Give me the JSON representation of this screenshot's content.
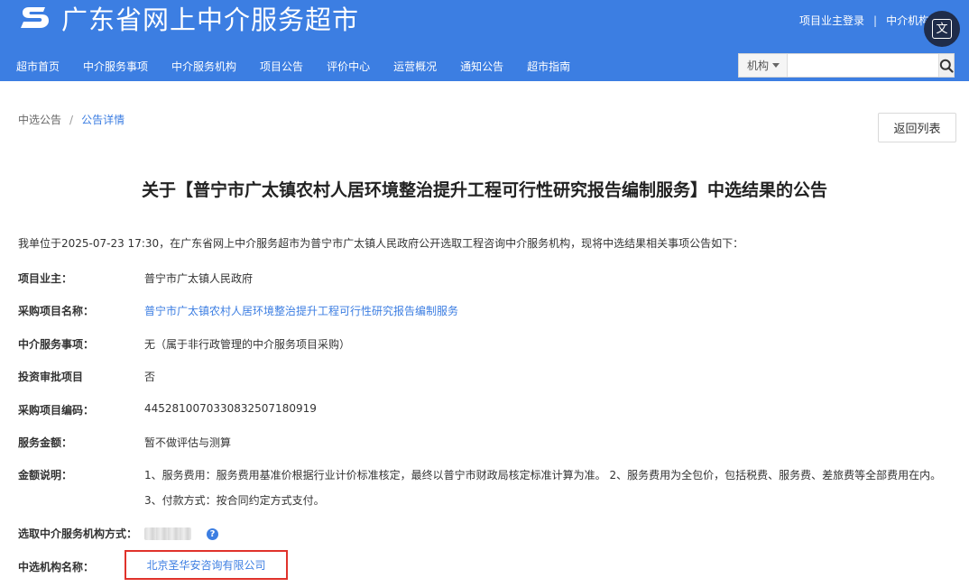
{
  "header": {
    "site_name": "广东省网上中介服务超市",
    "top_links": {
      "owner_login": "项目业主登录",
      "separator": "|",
      "agency_login": "中介机构"
    },
    "translate_label": "文",
    "nav": [
      "超市首页",
      "中介服务事项",
      "中介服务机构",
      "项目公告",
      "评价中心",
      "运营概况",
      "通知公告",
      "超市指南"
    ],
    "search": {
      "category": "机构",
      "value": "",
      "placeholder": ""
    }
  },
  "breadcrumb": {
    "parent": "中选公告",
    "separator": "/",
    "current": "公告详情"
  },
  "back_button": "返回列表",
  "title": "关于【普宁市广太镇农村人居环境整治提升工程可行性研究报告编制服务】中选结果的公告",
  "intro": "我单位于2025-07-23 17:30，在广东省网上中介服务超市为普宁市广太镇人民政府公开选取工程咨询中介服务机构，现将中选结果相关事项公告如下：",
  "fields": {
    "owner": {
      "label": "项目业主：",
      "value": "普宁市广太镇人民政府"
    },
    "project_name": {
      "label": "采购项目名称：",
      "value": "普宁市广太镇农村人居环境整治提升工程可行性研究报告编制服务"
    },
    "service_item": {
      "label": "中介服务事项：",
      "value": "无（属于非行政管理的中介服务项目采购）"
    },
    "investment_approval": {
      "label": "投资审批项目",
      "value": "否"
    },
    "project_code": {
      "label": "采购项目编码：",
      "value": "445281007033083250718091​9"
    },
    "amount": {
      "label": "服务金额：",
      "value": "暂不做评估与测算"
    },
    "amount_note": {
      "label": "金额说明：",
      "line1": "1、服务费用：服务费用基准价根据行业计价标准核定，最终以普宁市财政局核定标准计算为准。 2、服务费用为全包价，包括税费、服务费、差旅费等全部费用在内。",
      "line2": "3、付款方式：按合同约定方式支付。"
    },
    "selection_method": {
      "label": "选取中介服务机构方式："
    },
    "selected_agency": {
      "label": "中选机构名称：",
      "value": "北京圣华安咨询有限公司"
    }
  },
  "colors": {
    "brand_blue": "#3c7ee2",
    "highlight_red": "#e0322b",
    "translate_bg": "#1f2c4a"
  }
}
